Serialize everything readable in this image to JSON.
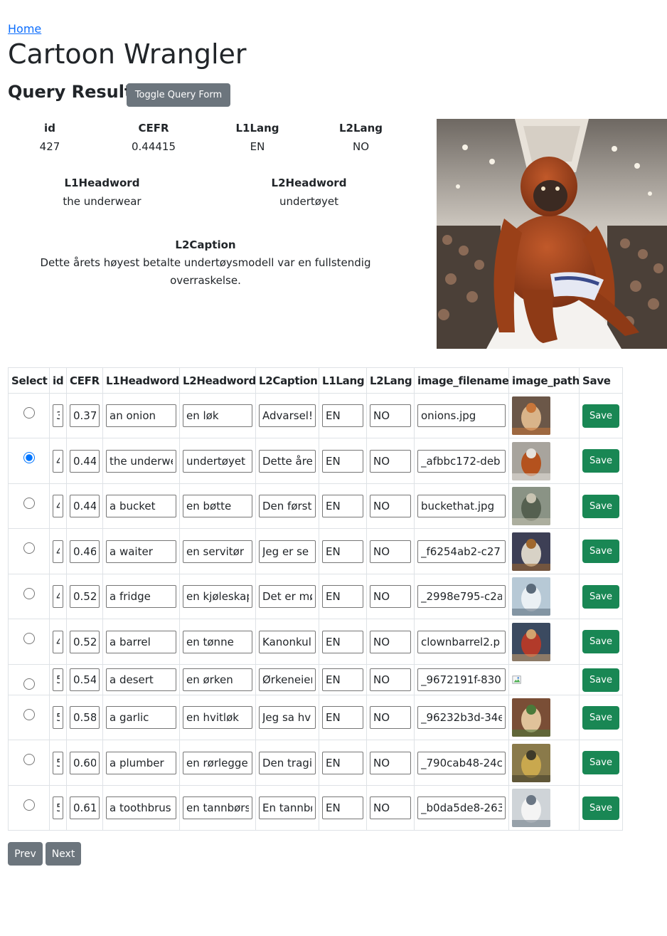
{
  "nav": {
    "home_link": "Home"
  },
  "page": {
    "title": "Cartoon Wrangler",
    "section_title": "Query Results",
    "toggle_label": "Toggle Query Form"
  },
  "detail": {
    "id_label": "id",
    "id": "427",
    "cefr_label": "CEFR",
    "cefr": "0.44415",
    "l1lang_label": "L1Lang",
    "l1lang": "EN",
    "l2lang_label": "L2Lang",
    "l2lang": "NO",
    "l1headword_label": "L1Headword",
    "l1headword": "the underwear",
    "l2headword_label": "L2Headword",
    "l2headword": "undertøyet",
    "l2caption_label": "L2Caption",
    "l2caption": "Dette årets høyest betalte undertøysmodell var en fullstendig overraskelse."
  },
  "table": {
    "headers": [
      "Select",
      "id",
      "CEFR",
      "L1Headword",
      "L2Headword",
      "L2Caption",
      "L1Lang",
      "L2Lang",
      "image_filename",
      "image_path",
      "Save"
    ],
    "rows": [
      {
        "selected": false,
        "id": "3",
        "cefr": "0.37",
        "l1": "an onion",
        "l2": "en løk",
        "caption": "Advarsel!",
        "l1lang": "EN",
        "l2lang": "NO",
        "filename": "onions.jpg",
        "image": "cartoon-thumbnail",
        "save": "Save"
      },
      {
        "selected": true,
        "id": "4",
        "cefr": "0.44",
        "l1": "the underwe",
        "l2": "undertøyet",
        "caption": "Dette åre",
        "l1lang": "EN",
        "l2lang": "NO",
        "filename": "_afbbc172-deb",
        "image": "cartoon-thumbnail",
        "save": "Save"
      },
      {
        "selected": false,
        "id": "4",
        "cefr": "0.44",
        "l1": "a bucket",
        "l2": "en bøtte",
        "caption": "Den først",
        "l1lang": "EN",
        "l2lang": "NO",
        "filename": "buckethat.jpg",
        "image": "cartoon-thumbnail",
        "save": "Save"
      },
      {
        "selected": false,
        "id": "4",
        "cefr": "0.46",
        "l1": "a waiter",
        "l2": "en servitør",
        "caption": "Jeg er se",
        "l1lang": "EN",
        "l2lang": "NO",
        "filename": "_f6254ab2-c27",
        "image": "cartoon-thumbnail",
        "save": "Save"
      },
      {
        "selected": false,
        "id": "4",
        "cefr": "0.52",
        "l1": "a fridge",
        "l2": "en kjøleskap",
        "caption": "Det er mø",
        "l1lang": "EN",
        "l2lang": "NO",
        "filename": "_2998e795-c2a",
        "image": "cartoon-thumbnail",
        "save": "Save"
      },
      {
        "selected": false,
        "id": "4",
        "cefr": "0.52",
        "l1": "a barrel",
        "l2": "en tønne",
        "caption": "Kanonkul",
        "l1lang": "EN",
        "l2lang": "NO",
        "filename": "clownbarrel2.p",
        "image": "cartoon-thumbnail",
        "save": "Save"
      },
      {
        "selected": false,
        "id": "5",
        "cefr": "0.54",
        "l1": "a desert",
        "l2": "en ørken",
        "caption": "Ørkeneier",
        "l1lang": "EN",
        "l2lang": "NO",
        "filename": "_9672191f-830",
        "image": "broken-image-icon",
        "save": "Save"
      },
      {
        "selected": false,
        "id": "5",
        "cefr": "0.58",
        "l1": "a garlic",
        "l2": "en hvitløk",
        "caption": "Jeg sa hv",
        "l1lang": "EN",
        "l2lang": "NO",
        "filename": "_96232b3d-34e",
        "image": "cartoon-thumbnail",
        "save": "Save"
      },
      {
        "selected": false,
        "id": "5",
        "cefr": "0.60",
        "l1": "a plumber",
        "l2": "en rørlegger",
        "caption": "Den tragi",
        "l1lang": "EN",
        "l2lang": "NO",
        "filename": "_790cab48-24c",
        "image": "cartoon-thumbnail",
        "save": "Save"
      },
      {
        "selected": false,
        "id": "5",
        "cefr": "0.61",
        "l1": "a toothbrus",
        "l2": "en tannbørs",
        "caption": "En tannbø",
        "l1lang": "EN",
        "l2lang": "NO",
        "filename": "_b0da5de8-263",
        "image": "cartoon-thumbnail",
        "save": "Save"
      }
    ]
  },
  "pagination": {
    "prev": "Prev",
    "next": "Next"
  },
  "colors": {
    "primary_link": "#0d6efd",
    "secondary_button": "#6c757d",
    "save_button": "#198754"
  }
}
